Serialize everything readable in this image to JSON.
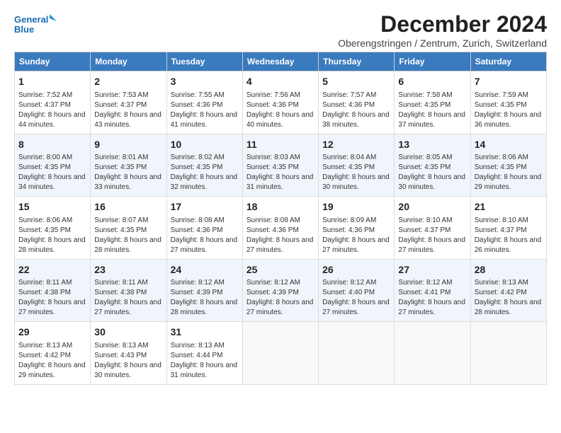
{
  "logo": {
    "line1": "General",
    "line2": "Blue"
  },
  "title": "December 2024",
  "subtitle": "Oberengstringen / Zentrum, Zurich, Switzerland",
  "headers": [
    "Sunday",
    "Monday",
    "Tuesday",
    "Wednesday",
    "Thursday",
    "Friday",
    "Saturday"
  ],
  "weeks": [
    [
      {
        "day": "1",
        "sunrise": "7:52 AM",
        "sunset": "4:37 PM",
        "daylight": "8 hours and 44 minutes."
      },
      {
        "day": "2",
        "sunrise": "7:53 AM",
        "sunset": "4:37 PM",
        "daylight": "8 hours and 43 minutes."
      },
      {
        "day": "3",
        "sunrise": "7:55 AM",
        "sunset": "4:36 PM",
        "daylight": "8 hours and 41 minutes."
      },
      {
        "day": "4",
        "sunrise": "7:56 AM",
        "sunset": "4:36 PM",
        "daylight": "8 hours and 40 minutes."
      },
      {
        "day": "5",
        "sunrise": "7:57 AM",
        "sunset": "4:36 PM",
        "daylight": "8 hours and 38 minutes."
      },
      {
        "day": "6",
        "sunrise": "7:58 AM",
        "sunset": "4:35 PM",
        "daylight": "8 hours and 37 minutes."
      },
      {
        "day": "7",
        "sunrise": "7:59 AM",
        "sunset": "4:35 PM",
        "daylight": "8 hours and 36 minutes."
      }
    ],
    [
      {
        "day": "8",
        "sunrise": "8:00 AM",
        "sunset": "4:35 PM",
        "daylight": "8 hours and 34 minutes."
      },
      {
        "day": "9",
        "sunrise": "8:01 AM",
        "sunset": "4:35 PM",
        "daylight": "8 hours and 33 minutes."
      },
      {
        "day": "10",
        "sunrise": "8:02 AM",
        "sunset": "4:35 PM",
        "daylight": "8 hours and 32 minutes."
      },
      {
        "day": "11",
        "sunrise": "8:03 AM",
        "sunset": "4:35 PM",
        "daylight": "8 hours and 31 minutes."
      },
      {
        "day": "12",
        "sunrise": "8:04 AM",
        "sunset": "4:35 PM",
        "daylight": "8 hours and 30 minutes."
      },
      {
        "day": "13",
        "sunrise": "8:05 AM",
        "sunset": "4:35 PM",
        "daylight": "8 hours and 30 minutes."
      },
      {
        "day": "14",
        "sunrise": "8:06 AM",
        "sunset": "4:35 PM",
        "daylight": "8 hours and 29 minutes."
      }
    ],
    [
      {
        "day": "15",
        "sunrise": "8:06 AM",
        "sunset": "4:35 PM",
        "daylight": "8 hours and 28 minutes."
      },
      {
        "day": "16",
        "sunrise": "8:07 AM",
        "sunset": "4:35 PM",
        "daylight": "8 hours and 28 minutes."
      },
      {
        "day": "17",
        "sunrise": "8:08 AM",
        "sunset": "4:36 PM",
        "daylight": "8 hours and 27 minutes."
      },
      {
        "day": "18",
        "sunrise": "8:08 AM",
        "sunset": "4:36 PM",
        "daylight": "8 hours and 27 minutes."
      },
      {
        "day": "19",
        "sunrise": "8:09 AM",
        "sunset": "4:36 PM",
        "daylight": "8 hours and 27 minutes."
      },
      {
        "day": "20",
        "sunrise": "8:10 AM",
        "sunset": "4:37 PM",
        "daylight": "8 hours and 27 minutes."
      },
      {
        "day": "21",
        "sunrise": "8:10 AM",
        "sunset": "4:37 PM",
        "daylight": "8 hours and 26 minutes."
      }
    ],
    [
      {
        "day": "22",
        "sunrise": "8:11 AM",
        "sunset": "4:38 PM",
        "daylight": "8 hours and 27 minutes."
      },
      {
        "day": "23",
        "sunrise": "8:11 AM",
        "sunset": "4:38 PM",
        "daylight": "8 hours and 27 minutes."
      },
      {
        "day": "24",
        "sunrise": "8:12 AM",
        "sunset": "4:39 PM",
        "daylight": "8 hours and 28 minutes."
      },
      {
        "day": "25",
        "sunrise": "8:12 AM",
        "sunset": "4:39 PM",
        "daylight": "8 hours and 27 minutes."
      },
      {
        "day": "26",
        "sunrise": "8:12 AM",
        "sunset": "4:40 PM",
        "daylight": "8 hours and 27 minutes."
      },
      {
        "day": "27",
        "sunrise": "8:12 AM",
        "sunset": "4:41 PM",
        "daylight": "8 hours and 27 minutes."
      },
      {
        "day": "28",
        "sunrise": "8:13 AM",
        "sunset": "4:42 PM",
        "daylight": "8 hours and 28 minutes."
      }
    ],
    [
      {
        "day": "29",
        "sunrise": "8:13 AM",
        "sunset": "4:42 PM",
        "daylight": "8 hours and 29 minutes."
      },
      {
        "day": "30",
        "sunrise": "8:13 AM",
        "sunset": "4:43 PM",
        "daylight": "8 hours and 30 minutes."
      },
      {
        "day": "31",
        "sunrise": "8:13 AM",
        "sunset": "4:44 PM",
        "daylight": "8 hours and 31 minutes."
      },
      null,
      null,
      null,
      null
    ]
  ],
  "labels": {
    "sunrise": "Sunrise:",
    "sunset": "Sunset:",
    "daylight": "Daylight:"
  }
}
